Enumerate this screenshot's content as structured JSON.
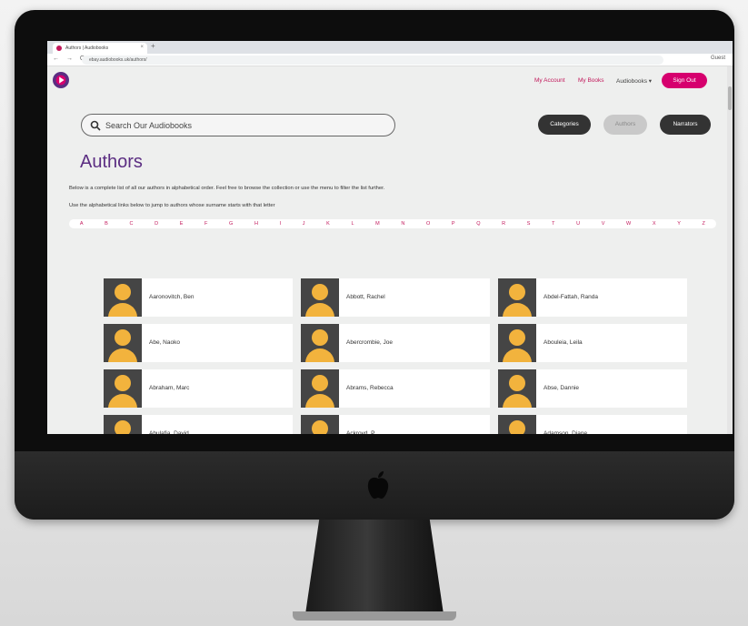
{
  "browser": {
    "tab_title": "Authors | Audiobooks",
    "tab_close": "×",
    "new_tab": "+",
    "nav_icons": "← → C",
    "url": "ebay.audiobooks.uk/authors/",
    "profile": "Guest"
  },
  "header": {
    "nav": [
      "My Account",
      "My Books",
      "Audiobooks ▾"
    ],
    "sign_out": "Sign Out"
  },
  "search": {
    "placeholder": "Search Our Audiobooks"
  },
  "filters": [
    {
      "label": "Categories",
      "active": false
    },
    {
      "label": "Authors",
      "active": true
    },
    {
      "label": "Narrators",
      "active": false
    }
  ],
  "page": {
    "title": "Authors",
    "intro_1": "Below is a complete list of all our authors in alphabetical order. Feel free to browse the collection or use the menu to filter the list further.",
    "intro_2": "Use the alphabetical links below to jump to authors whose surname starts with that letter"
  },
  "alphabet": [
    "A",
    "B",
    "C",
    "D",
    "E",
    "F",
    "G",
    "H",
    "I",
    "J",
    "K",
    "L",
    "M",
    "N",
    "O",
    "P",
    "Q",
    "R",
    "S",
    "T",
    "U",
    "V",
    "W",
    "X",
    "Y",
    "Z"
  ],
  "authors": [
    "Aaronovitch, Ben",
    "Abbott, Rachel",
    "Abdel-Fattah, Randa",
    "Abe, Naoko",
    "Abercrombie, Joe",
    "Abouleia, Leila",
    "Abraham, Marc",
    "Abrams, Rebecca",
    "Abse, Dannie",
    "Abulafia, David",
    "Ackroyd, P",
    "Adamson, Diane"
  ],
  "colors": {
    "brand": "#c2185b",
    "title": "#5b2d82",
    "avatar_bg": "#454545",
    "avatar_fg": "#f2b33d"
  }
}
